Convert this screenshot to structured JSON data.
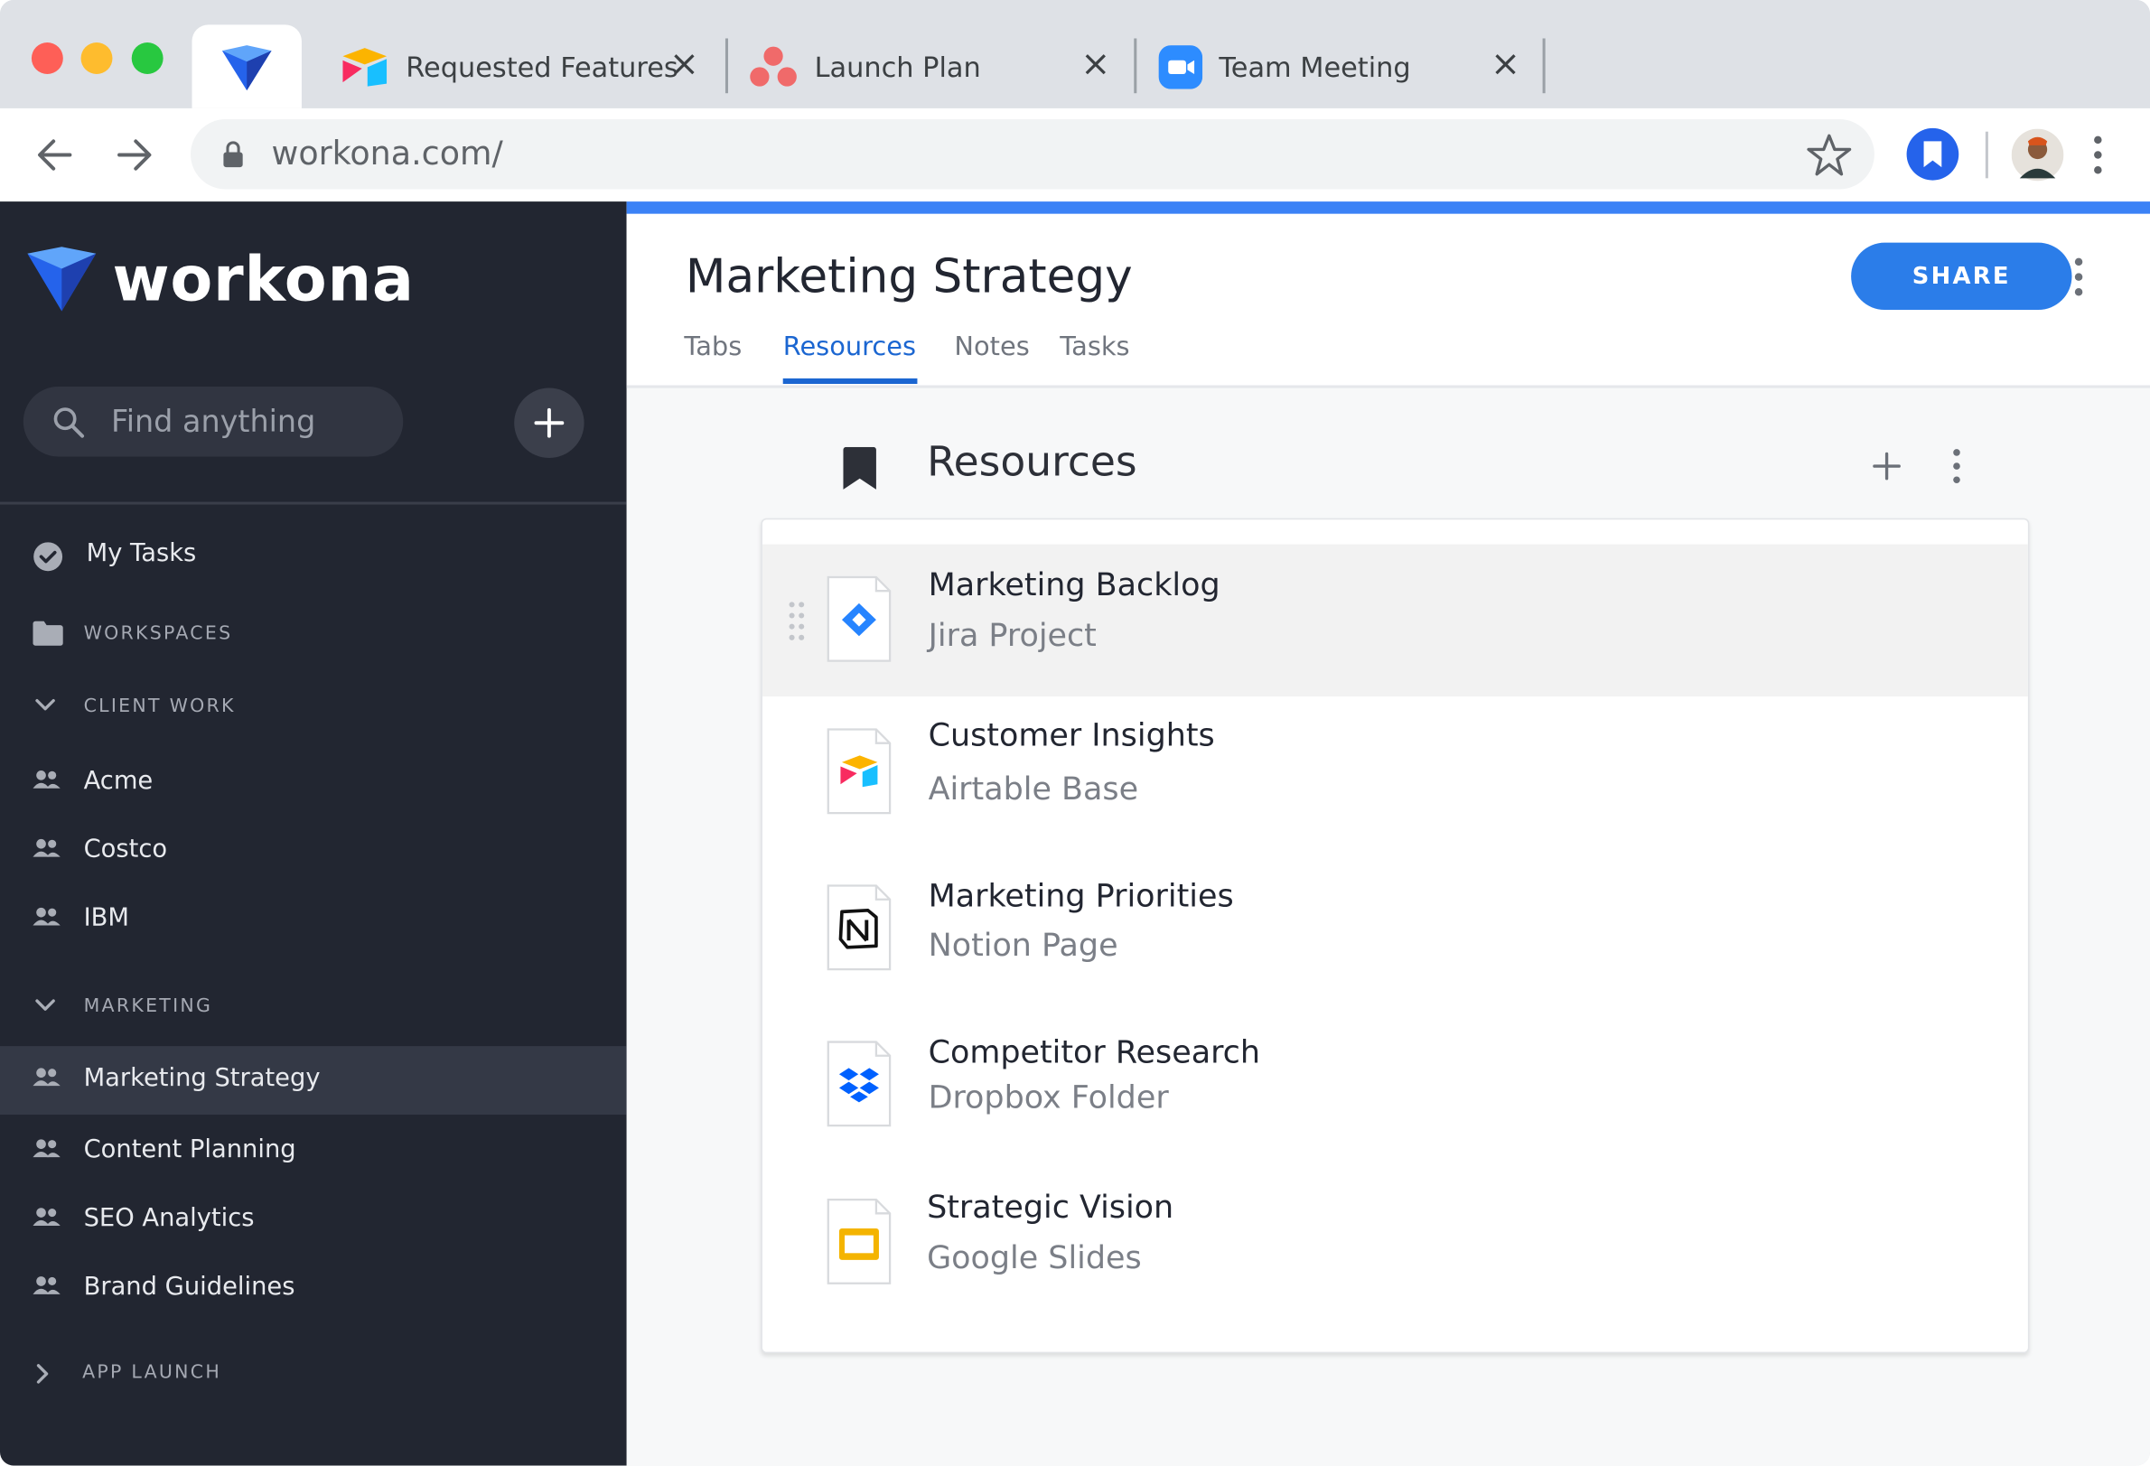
{
  "browser": {
    "tabs": [
      {
        "title": "",
        "icon": "workona-icon",
        "active": true
      },
      {
        "title": "Requested Features",
        "icon": "airtable-icon",
        "active": false
      },
      {
        "title": "Launch Plan",
        "icon": "asana-icon",
        "active": false
      },
      {
        "title": "Team Meeting",
        "icon": "zoom-icon",
        "active": false
      }
    ],
    "url": "workona.com/"
  },
  "sidebar": {
    "logo": "workona",
    "search_placeholder": "Find anything",
    "my_tasks": "My Tasks",
    "workspaces_header": "WORKSPACES",
    "groups": [
      {
        "title": "CLIENT WORK",
        "expanded": true,
        "items": [
          "Acme",
          "Costco",
          "IBM"
        ]
      },
      {
        "title": "MARKETING",
        "expanded": true,
        "items": [
          "Marketing Strategy",
          "Content Planning",
          "SEO Analytics",
          "Brand Guidelines"
        ]
      },
      {
        "title": "APP LAUNCH",
        "expanded": false,
        "items": []
      }
    ],
    "active_item": "Marketing Strategy"
  },
  "main": {
    "title": "Marketing Strategy",
    "share_label": "SHARE",
    "tabs": [
      "Tabs",
      "Resources",
      "Notes",
      "Tasks"
    ],
    "active_tab": "Resources",
    "section_title": "Resources",
    "resources": [
      {
        "name": "Marketing Backlog",
        "type": "Jira Project",
        "icon": "jira-icon"
      },
      {
        "name": "Customer Insights",
        "type": "Airtable Base",
        "icon": "airtable-icon"
      },
      {
        "name": "Marketing Priorities",
        "type": "Notion Page",
        "icon": "notion-icon"
      },
      {
        "name": "Competitor Research",
        "type": "Dropbox Folder",
        "icon": "dropbox-icon"
      },
      {
        "name": "Strategic Vision",
        "type": "Google Slides",
        "icon": "google-slides-icon"
      }
    ]
  },
  "colors": {
    "accent": "#2b7de9",
    "sidebar_bg": "#222631",
    "active_tab": "#1b66d1"
  }
}
